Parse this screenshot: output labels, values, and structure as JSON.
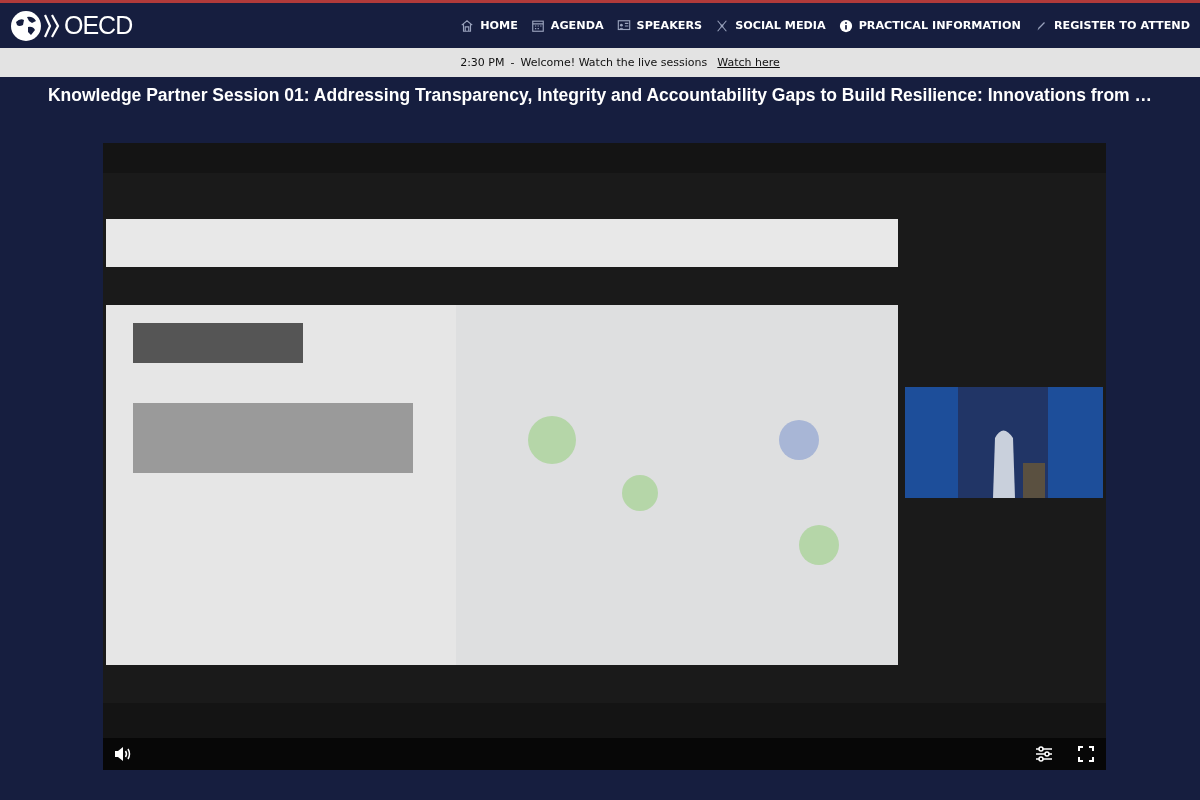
{
  "header": {
    "logo_text": "OECD",
    "nav": [
      {
        "label": "HOME",
        "kind": "home"
      },
      {
        "label": "AGENDA",
        "kind": "calendar"
      },
      {
        "label": "SPEAKERS",
        "kind": "speakers"
      },
      {
        "label": "SOCIAL MEDIA",
        "kind": "network"
      },
      {
        "label": "PRACTICAL INFORMATION",
        "kind": "info"
      },
      {
        "label": "REGISTER TO ATTEND",
        "kind": "pencil"
      }
    ]
  },
  "ticker": {
    "time": "2:30 PM",
    "separator": "-",
    "message": "Welcome! Watch the live sessions",
    "link": "Watch here"
  },
  "session_title": "Knowledge Partner Session 01: Addressing Transparency, Integrity and Accountability Gaps to Build Resilience: Innovations from …",
  "video": {
    "kind": "picture",
    "controls": [
      {
        "kind": "volume"
      },
      {
        "kind": "settings"
      },
      {
        "kind": "fullscreen"
      }
    ]
  }
}
